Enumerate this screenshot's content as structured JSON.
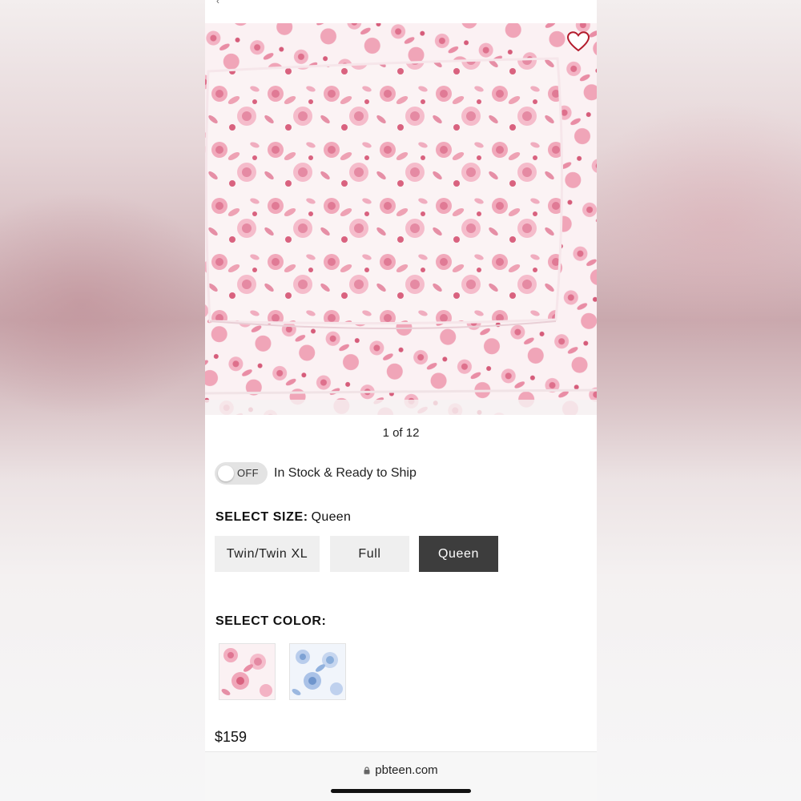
{
  "gallery": {
    "counter": "1 of 12",
    "favorite_icon": "heart-outline-icon"
  },
  "filters": {
    "toggle_state": "OFF",
    "stock_label": "In Stock & Ready to Ship"
  },
  "size": {
    "heading": "SELECT SIZE:",
    "selected": "Queen",
    "options": [
      "Twin/Twin XL",
      "Full",
      "Queen"
    ]
  },
  "color": {
    "heading": "SELECT COLOR:",
    "options": [
      "pink-floral",
      "blue-floral"
    ]
  },
  "price": "$159",
  "browser": {
    "url": "pbteen.com"
  },
  "colors": {
    "floral_pink": "#e07a95",
    "floral_blue": "#7ea2d4",
    "selected_button": "#3d3d3d",
    "heart_outline": "#b31b2c"
  }
}
